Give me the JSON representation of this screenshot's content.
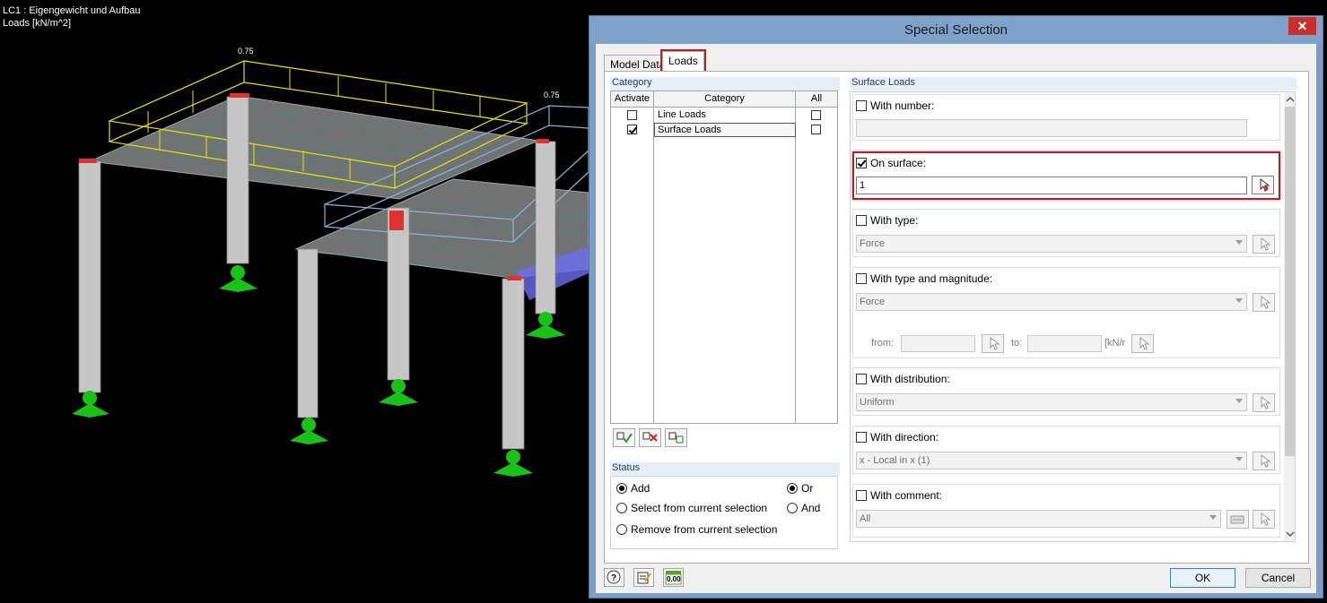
{
  "viewport": {
    "load_case": "LC1 : Eigengewicht und Aufbau",
    "units": "Loads [kN/m^2]",
    "load_value_1": "0.75",
    "load_value_2": "0.75"
  },
  "dialog": {
    "title": "Special Selection",
    "close_glyph": "✕",
    "tabs": [
      {
        "label": "Model Data",
        "active": false
      },
      {
        "label": "Loads",
        "active": true
      }
    ],
    "category": {
      "group_title": "Category",
      "col_activate": "Activate",
      "col_category": "Category",
      "col_all": "All",
      "rows": [
        {
          "label": "Line Loads",
          "activate": false,
          "all": false
        },
        {
          "label": "Surface Loads",
          "activate": true,
          "all": false
        }
      ],
      "buttons": [
        "select-all-icon",
        "deselect-all-icon",
        "invert-icon"
      ]
    },
    "status": {
      "group_title": "Status",
      "add": "Add",
      "select_from": "Select from current selection",
      "remove_from": "Remove from current selection",
      "or": "Or",
      "and": "And",
      "selected_mode": "Add",
      "selected_logic": "Or"
    },
    "surface_loads": {
      "group_title": "Surface Loads",
      "with_number": {
        "label": "With number:",
        "checked": false,
        "value": ""
      },
      "on_surface": {
        "label": "On surface:",
        "checked": true,
        "value": "1"
      },
      "with_type": {
        "label": "With type:",
        "checked": false,
        "value": "Force"
      },
      "with_type_magnitude": {
        "label": "With type and magnitude:",
        "checked": false,
        "value": "Force",
        "from_label": "from:",
        "to_label": "to:",
        "unit": "[kN/r"
      },
      "with_distribution": {
        "label": "With distribution:",
        "checked": false,
        "value": "Uniform"
      },
      "with_direction": {
        "label": "With direction:",
        "checked": false,
        "value": "x - Local in x (1)"
      },
      "with_comment": {
        "label": "With comment:",
        "checked": false,
        "value": "All"
      }
    },
    "footer": {
      "ok": "OK",
      "cancel": "Cancel",
      "icons": [
        "help-icon",
        "edit-icon",
        "units-icon"
      ],
      "units_icon_text": "0.00"
    }
  }
}
